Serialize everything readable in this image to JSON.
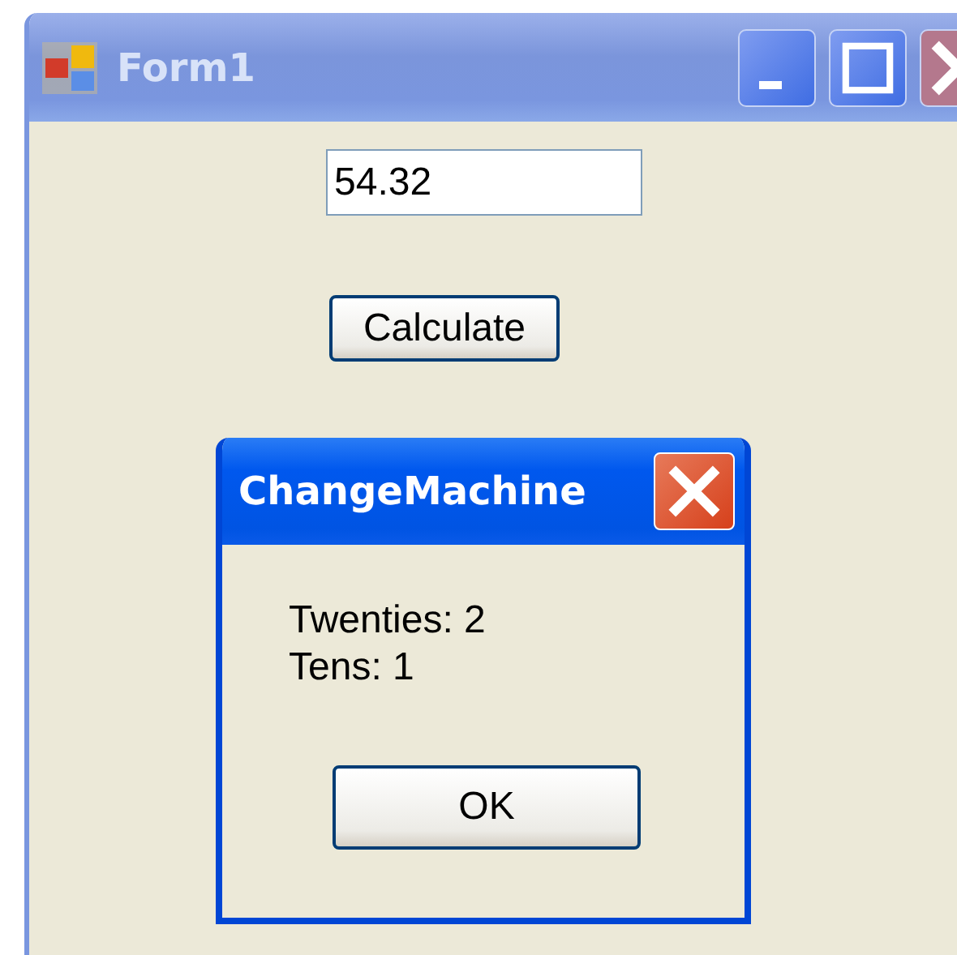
{
  "window": {
    "title": "Form1",
    "active": false
  },
  "amount_field": {
    "value": "54.32"
  },
  "calculate_button": {
    "label": "Calculate"
  },
  "dialog": {
    "title": "ChangeMachine",
    "active": true,
    "lines": [
      "Twenties: 2",
      "Tens: 1"
    ],
    "button": "OK"
  }
}
